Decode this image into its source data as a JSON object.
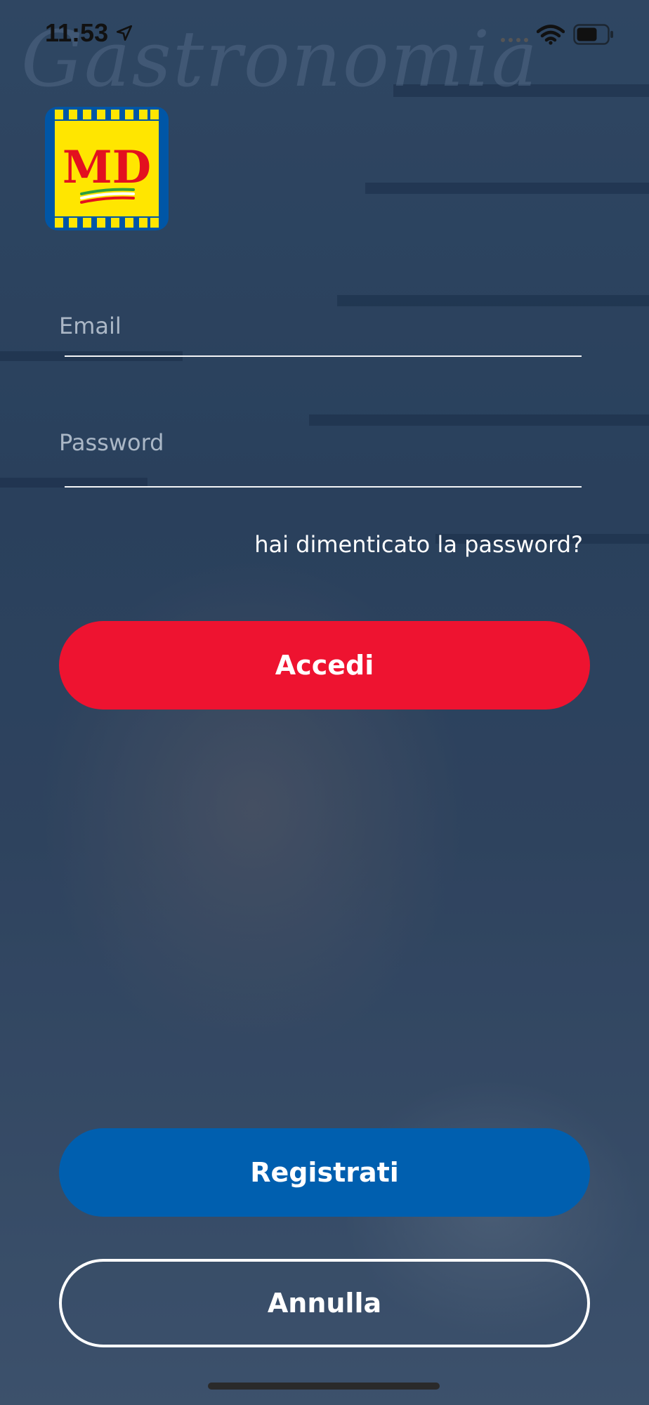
{
  "status_bar": {
    "time": "11:53",
    "location_icon": "location-arrow-icon",
    "signal_icon": "cellular-signal-icon",
    "wifi_icon": "wifi-icon",
    "battery_icon": "battery-icon"
  },
  "background": {
    "sign_text": "Gastronomia"
  },
  "logo": {
    "text": "MD",
    "colors": {
      "background": "#ffe600",
      "border": "#0056a6",
      "text": "#e3101f"
    }
  },
  "form": {
    "email_placeholder": "Email",
    "email_value": "",
    "password_placeholder": "Password",
    "password_value": ""
  },
  "forgot_password_label": "hai dimenticato la password?",
  "buttons": {
    "login_label": "Accedi",
    "register_label": "Registrati",
    "cancel_label": "Annulla"
  },
  "colors": {
    "login": "#ee1330",
    "register": "#005faf",
    "overlay": "#1a345a"
  }
}
